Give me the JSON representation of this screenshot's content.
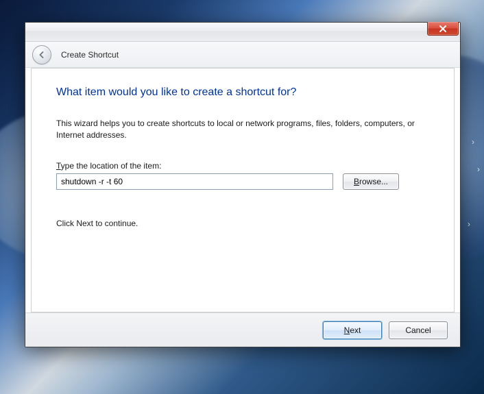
{
  "window": {
    "title": "Create Shortcut"
  },
  "content": {
    "heading": "What item would you like to create a shortcut for?",
    "description": "This wizard helps you to create shortcuts to local or network programs, files, folders, computers, or Internet addresses.",
    "field_label_prefix": "T",
    "field_label_rest": "ype the location of the item:",
    "input_value": "shutdown -r -t 60",
    "browse_prefix": "B",
    "browse_rest": "rowse...",
    "hint": "Click Next to continue."
  },
  "footer": {
    "next_prefix": "N",
    "next_rest": "ext",
    "cancel": "Cancel"
  }
}
